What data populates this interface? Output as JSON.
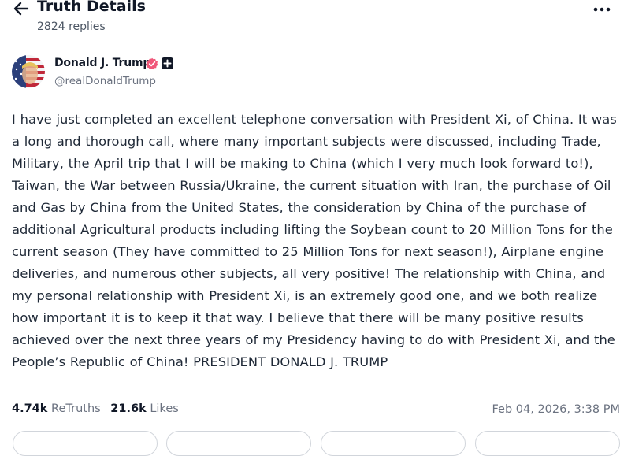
{
  "header": {
    "back_icon": "arrow-left-icon",
    "title": "Truth Details",
    "replies": "2824 replies",
    "more_icon": "more-horizontal-icon"
  },
  "author": {
    "name": "Donald J. Trump",
    "handle": "@realDonaldTrump",
    "verified_icon": "verified-badge-icon",
    "verified_color": "#f0577a",
    "plus_icon": "plus-badge-icon"
  },
  "post": {
    "text": "I have just completed an excellent telephone conversation with President Xi, of China. It was a long and thorough call, where many important subjects were discussed, including Trade, Military, the April trip that I will be making to China (which I very much look forward to!), Taiwan, the War between Russia/Ukraine, the current situation with Iran, the purchase of Oil and Gas by China from the United States, the consideration by China of the purchase of additional Agricultural products including lifting the Soybean count to 20 Million Tons for the current season (They have committed to 25 Million Tons for next season!), Airplane engine deliveries, and numerous other subjects, all very positive! The relationship with China, and my personal relationship with President Xi, is an extremely good one, and we both realize how important it is to keep it that way. I believe that there will be many positive results achieved over the next three years of my Presidency having to do with President Xi, and the People’s Republic of China! PRESIDENT DONALD J. TRUMP",
    "retruths_count": "4.74k",
    "retruths_label": "ReTruths",
    "likes_count": "21.6k",
    "likes_label": "Likes",
    "timestamp": "Feb 04, 2026, 3:38 PM"
  },
  "colors": {
    "text": "#111827",
    "muted": "#6b7280",
    "border": "#d1d5db"
  }
}
